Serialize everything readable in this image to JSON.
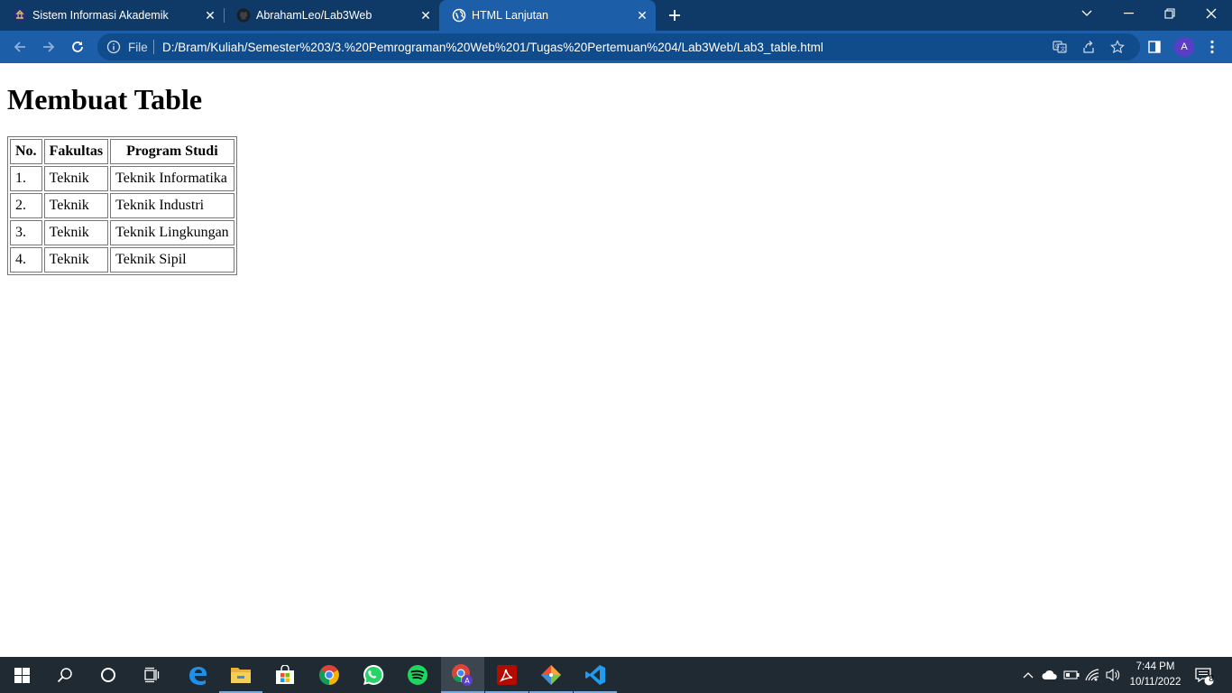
{
  "browser": {
    "tabs": [
      {
        "title": "Sistem Informasi Akademik",
        "icon": "university-icon",
        "active": false
      },
      {
        "title": "AbrahamLeo/Lab3Web",
        "icon": "github-icon",
        "active": false
      },
      {
        "title": "HTML Lanjutan",
        "icon": "globe-icon",
        "active": true
      }
    ],
    "address": {
      "scheme_label": "File",
      "url": "D:/Bram/Kuliah/Semester%203/3.%20Pemrograman%20Web%201/Tugas%20Pertemuan%204/Lab3Web/Lab3_table.html"
    },
    "profile_initial": "A",
    "colors": {
      "tabstrip": "#0f3a68",
      "toolbar": "#1d5ea8",
      "omnibox": "#104b8c"
    }
  },
  "page": {
    "heading": "Membuat Table",
    "table": {
      "headers": [
        "No.",
        "Fakultas",
        "Program Studi"
      ],
      "rows": [
        [
          "1.",
          "Teknik",
          "Teknik Informatika"
        ],
        [
          "2.",
          "Teknik",
          "Teknik Industri"
        ],
        [
          "3.",
          "Teknik",
          "Teknik Lingkungan"
        ],
        [
          "4.",
          "Teknik",
          "Teknik Sipil"
        ]
      ]
    }
  },
  "taskbar": {
    "apps": [
      "start-icon",
      "search-icon",
      "cortana-icon",
      "task-view-icon",
      "edge-icon",
      "file-explorer-icon",
      "store-icon",
      "chrome-icon",
      "whatsapp-icon",
      "spotify-icon",
      "chrome-profile-icon",
      "acrobat-icon",
      "git-icon",
      "vscode-icon"
    ],
    "clock": {
      "time": "7:44 PM",
      "date": "10/11/2022"
    },
    "notification_count": "8"
  }
}
